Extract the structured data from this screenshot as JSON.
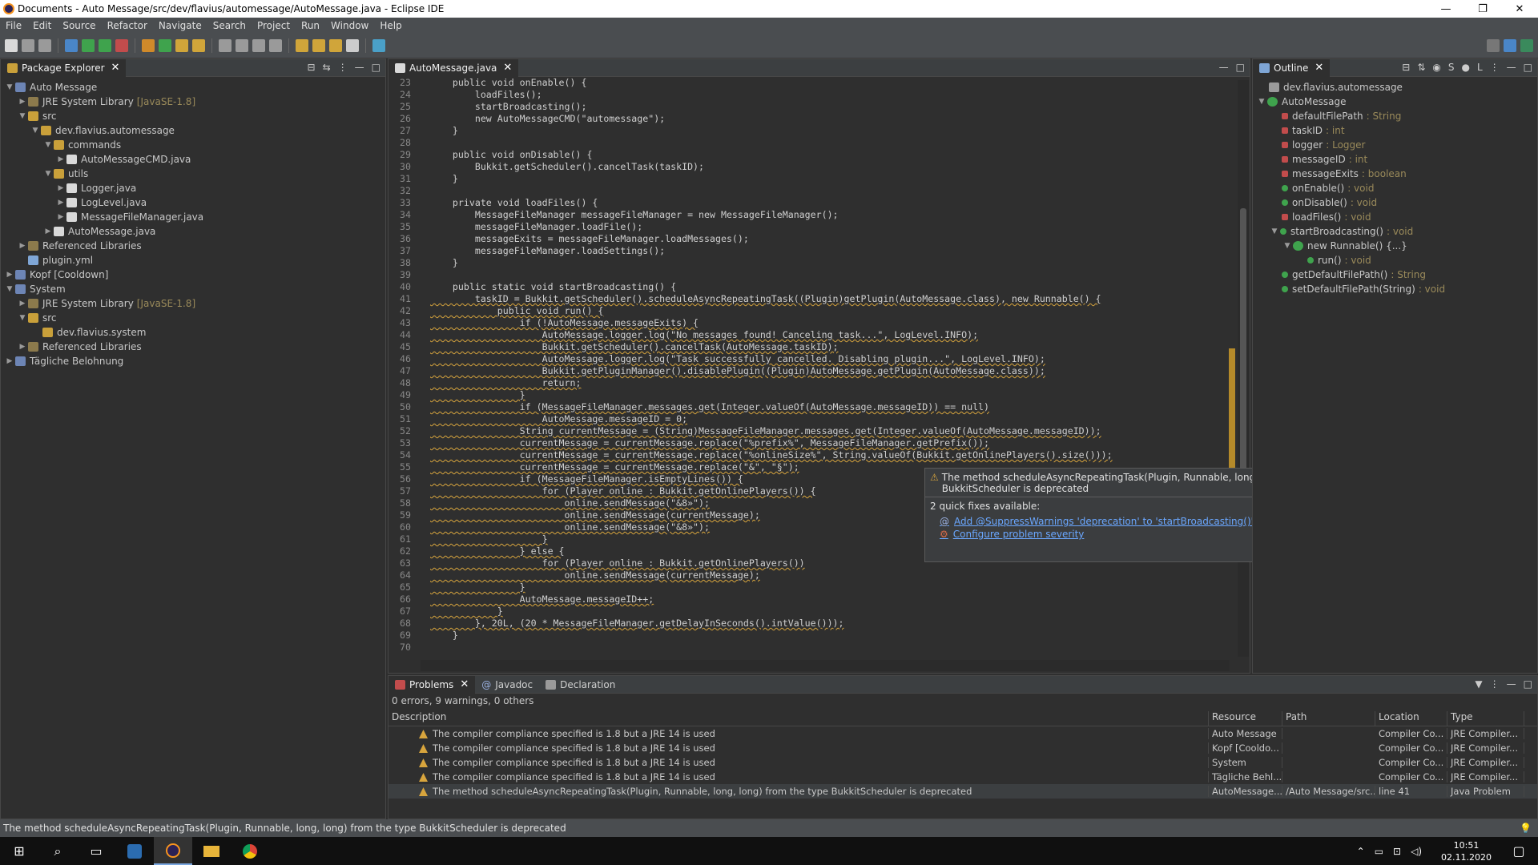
{
  "window": {
    "title": "Documents - Auto Message/src/dev/flavius/automessage/AutoMessage.java - Eclipse IDE"
  },
  "menu": [
    "File",
    "Edit",
    "Source",
    "Refactor",
    "Navigate",
    "Search",
    "Project",
    "Run",
    "Window",
    "Help"
  ],
  "package_explorer": {
    "tab_label": "Package Explorer",
    "items": [
      {
        "label": "Auto Message",
        "decoration": ""
      },
      {
        "label": "JRE System Library",
        "decoration": "[JavaSE-1.8]"
      },
      {
        "label": "src",
        "decoration": ""
      },
      {
        "label": "dev.flavius.automessage",
        "decoration": ""
      },
      {
        "label": "commands",
        "decoration": ""
      },
      {
        "label": "AutoMessageCMD.java",
        "decoration": ""
      },
      {
        "label": "utils",
        "decoration": ""
      },
      {
        "label": "Logger.java",
        "decoration": ""
      },
      {
        "label": "LogLevel.java",
        "decoration": ""
      },
      {
        "label": "MessageFileManager.java",
        "decoration": ""
      },
      {
        "label": "AutoMessage.java",
        "decoration": ""
      },
      {
        "label": "Referenced Libraries",
        "decoration": ""
      },
      {
        "label": "plugin.yml",
        "decoration": ""
      },
      {
        "label": "Kopf [Cooldown]",
        "decoration": ""
      },
      {
        "label": "System",
        "decoration": ""
      },
      {
        "label": "JRE System Library",
        "decoration": "[JavaSE-1.8]"
      },
      {
        "label": "src",
        "decoration": ""
      },
      {
        "label": "dev.flavius.system",
        "decoration": ""
      },
      {
        "label": "Referenced Libraries",
        "decoration": ""
      },
      {
        "label": "Tägliche Belohnung",
        "decoration": ""
      }
    ]
  },
  "editor": {
    "tab_label": "AutoMessage.java",
    "lines": [
      {
        "n": "23",
        "code": "    public void onEnable() {"
      },
      {
        "n": "24",
        "code": "        loadFiles();"
      },
      {
        "n": "25",
        "code": "        startBroadcasting();"
      },
      {
        "n": "26",
        "code": "        new AutoMessageCMD(\"automessage\");"
      },
      {
        "n": "27",
        "code": "    }"
      },
      {
        "n": "28",
        "code": ""
      },
      {
        "n": "29",
        "code": "    public void onDisable() {"
      },
      {
        "n": "30",
        "code": "        Bukkit.getScheduler().cancelTask(taskID);"
      },
      {
        "n": "31",
        "code": "    }"
      },
      {
        "n": "32",
        "code": ""
      },
      {
        "n": "33",
        "code": "    private void loadFiles() {"
      },
      {
        "n": "34",
        "code": "        MessageFileManager messageFileManager = new MessageFileManager();"
      },
      {
        "n": "35",
        "code": "        messageFileManager.loadFile();"
      },
      {
        "n": "36",
        "code": "        messageExits = messageFileManager.loadMessages();"
      },
      {
        "n": "37",
        "code": "        messageFileManager.loadSettings();"
      },
      {
        "n": "38",
        "code": "    }"
      },
      {
        "n": "39",
        "code": ""
      },
      {
        "n": "40",
        "code": "    public static void startBroadcasting() {"
      },
      {
        "n": "41",
        "code": "        taskID = Bukkit.getScheduler().scheduleAsyncRepeatingTask((Plugin)getPlugin(AutoMessage.class), new Runnable() {"
      },
      {
        "n": "42",
        "code": "            public void run() {"
      },
      {
        "n": "43",
        "code": "                if (!AutoMessage.messageExits) {"
      },
      {
        "n": "44",
        "code": "                    AutoMessage.logger.log(\"No messages found! Canceling task...\", LogLevel.INFO);"
      },
      {
        "n": "45",
        "code": "                    Bukkit.getScheduler().cancelTask(AutoMessage.taskID);"
      },
      {
        "n": "46",
        "code": "                    AutoMessage.logger.log(\"Task successfully cancelled. Disabling plugin...\", LogLevel.INFO);"
      },
      {
        "n": "47",
        "code": "                    Bukkit.getPluginManager().disablePlugin((Plugin)AutoMessage.getPlugin(AutoMessage.class));"
      },
      {
        "n": "48",
        "code": "                    return;"
      },
      {
        "n": "49",
        "code": "                }"
      },
      {
        "n": "50",
        "code": "                if (MessageFileManager.messages.get(Integer.valueOf(AutoMessage.messageID)) == null)"
      },
      {
        "n": "51",
        "code": "                    AutoMessage.messageID = 0;"
      },
      {
        "n": "52",
        "code": "                String currentMessage = (String)MessageFileManager.messages.get(Integer.valueOf(AutoMessage.messageID));"
      },
      {
        "n": "53",
        "code": "                currentMessage = currentMessage.replace(\"%prefix%\", MessageFileManager.getPrefix());"
      },
      {
        "n": "54",
        "code": "                currentMessage = currentMessage.replace(\"%onlineSize%\", String.valueOf(Bukkit.getOnlinePlayers().size()));"
      },
      {
        "n": "55",
        "code": "                currentMessage = currentMessage.replace(\"&\", \"§\");"
      },
      {
        "n": "56",
        "code": "                if (MessageFileManager.isEmptyLines()) {"
      },
      {
        "n": "57",
        "code": "                    for (Player online : Bukkit.getOnlinePlayers()) {"
      },
      {
        "n": "58",
        "code": "                        online.sendMessage(\"&8»\");"
      },
      {
        "n": "59",
        "code": "                        online.sendMessage(currentMessage);"
      },
      {
        "n": "60",
        "code": "                        online.sendMessage(\"&8»\");"
      },
      {
        "n": "61",
        "code": "                    }"
      },
      {
        "n": "62",
        "code": "                } else {"
      },
      {
        "n": "63",
        "code": "                    for (Player online : Bukkit.getOnlinePlayers())"
      },
      {
        "n": "64",
        "code": "                        online.sendMessage(currentMessage);"
      },
      {
        "n": "65",
        "code": "                }"
      },
      {
        "n": "66",
        "code": "                AutoMessage.messageID++;"
      },
      {
        "n": "67",
        "code": "            }"
      },
      {
        "n": "68",
        "code": "        }, 20L, (20 * MessageFileManager.getDelayInSeconds().intValue()));"
      },
      {
        "n": "69",
        "code": "    }"
      },
      {
        "n": "70",
        "code": ""
      }
    ]
  },
  "popup": {
    "message": "The method scheduleAsyncRepeatingTask(Plugin, Runnable, long, long) from the type BukkitScheduler is deprecated",
    "fixes_title": "2 quick fixes available:",
    "fixes": [
      "Add @SuppressWarnings 'deprecation' to 'startBroadcasting()'",
      "Configure problem severity"
    ]
  },
  "outline": {
    "tab_label": "Outline",
    "items": [
      {
        "label": "dev.flavius.automessage",
        "type": ""
      },
      {
        "label": "AutoMessage",
        "type": ""
      },
      {
        "label": "defaultFilePath",
        "type": " : String"
      },
      {
        "label": "taskID",
        "type": " : int"
      },
      {
        "label": "logger",
        "type": " : Logger"
      },
      {
        "label": "messageID",
        "type": " : int"
      },
      {
        "label": "messageExits",
        "type": " : boolean"
      },
      {
        "label": "onEnable()",
        "type": " : void"
      },
      {
        "label": "onDisable()",
        "type": " : void"
      },
      {
        "label": "loadFiles()",
        "type": " : void"
      },
      {
        "label": "startBroadcasting()",
        "type": " : void"
      },
      {
        "label": "new Runnable() {...}",
        "type": ""
      },
      {
        "label": "run()",
        "type": " : void"
      },
      {
        "label": "getDefaultFilePath()",
        "type": " : String"
      },
      {
        "label": "setDefaultFilePath(String)",
        "type": " : void"
      }
    ]
  },
  "problems": {
    "tabs": [
      "Problems",
      "Javadoc",
      "Declaration"
    ],
    "summary": "0 errors, 9 warnings, 0 others",
    "columns": [
      "Description",
      "Resource",
      "Path",
      "Location",
      "Type"
    ],
    "rows": [
      {
        "description": "The compiler compliance specified is 1.8 but a JRE 14 is used",
        "resource": "Auto Message",
        "path": "",
        "location": "Compiler Co...",
        "type": "JRE Compiler..."
      },
      {
        "description": "The compiler compliance specified is 1.8 but a JRE 14 is used",
        "resource": "Kopf [Cooldo...",
        "path": "",
        "location": "Compiler Co...",
        "type": "JRE Compiler..."
      },
      {
        "description": "The compiler compliance specified is 1.8 but a JRE 14 is used",
        "resource": "System",
        "path": "",
        "location": "Compiler Co...",
        "type": "JRE Compiler..."
      },
      {
        "description": "The compiler compliance specified is 1.8 but a JRE 14 is used",
        "resource": "Tägliche Behl...",
        "path": "",
        "location": "Compiler Co...",
        "type": "JRE Compiler..."
      },
      {
        "description": "The method scheduleAsyncRepeatingTask(Plugin, Runnable, long, long) from the type BukkitScheduler is deprecated",
        "resource": "AutoMessage...",
        "path": "/Auto Message/src...",
        "location": "line 41",
        "type": "Java Problem"
      }
    ]
  },
  "status": {
    "text": "The method scheduleAsyncRepeatingTask(Plugin, Runnable, long, long) from the type BukkitScheduler is deprecated"
  },
  "taskbar": {
    "time": "10:51",
    "date": "02.11.2020"
  }
}
